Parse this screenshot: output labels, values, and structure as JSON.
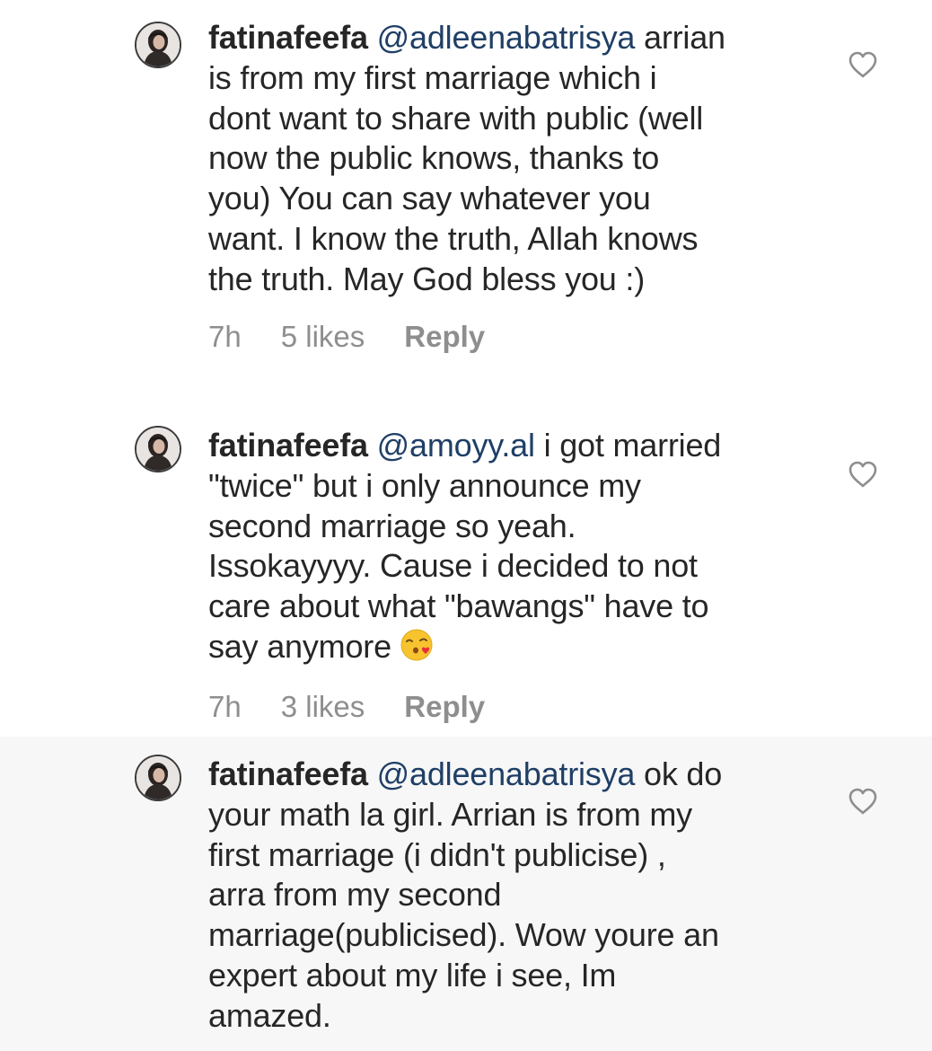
{
  "comments": [
    {
      "username": "fatinafeefa",
      "mention": "@adleenabatrisya",
      "lines": [
        " arrian",
        "is  from my first marriage which i",
        "dont want to share with public (well",
        "now the public knows, thanks to",
        "you) You can say whatever you",
        "want. I know the truth, Allah knows",
        "the truth. May God bless you :)"
      ],
      "time": "7h",
      "likes": "5 likes",
      "reply": "Reply"
    },
    {
      "username": "fatinafeefa",
      "mention": "@amoyy.al",
      "lines": [
        " i got married",
        "\"twice\" but i only announce my",
        "second marriage so yeah.",
        "Issokayyyy. Cause i decided to not",
        "care about what \"bawangs\" have to",
        "say anymore"
      ],
      "emoji": "face-blowing-kiss-emoji",
      "time": "7h",
      "likes": "3 likes",
      "reply": "Reply"
    },
    {
      "username": "fatinafeefa",
      "mention": "@adleenabatrisya",
      "lines": [
        " ok do",
        "your math la girl. Arrian is from my",
        "first marriage (i didn't publicise) ,",
        "arra from my second",
        "marriage(publicised). Wow youre an",
        "expert about my life i see, Im",
        "amazed."
      ]
    }
  ],
  "icons": {
    "avatar": "user-avatar",
    "heart": "heart-outline-icon"
  },
  "colors": {
    "text": "#262626",
    "meta": "#8e8e8e",
    "mention": "#1f3f66",
    "highlight_bg": "#f7f7f7"
  }
}
